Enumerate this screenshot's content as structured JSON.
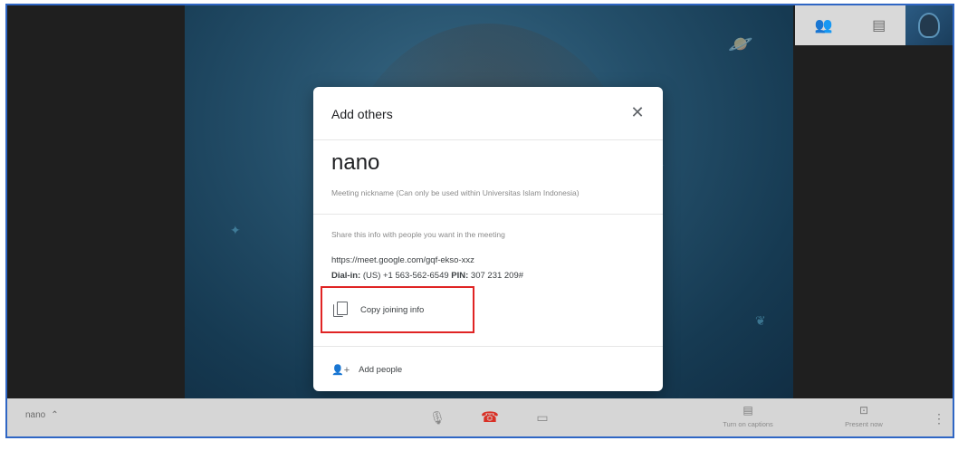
{
  "dialog": {
    "title": "Add others",
    "nickname": "nano",
    "nickname_note": "Meeting nickname (Can only be used within Universitas Islam Indonesia)",
    "share_note": "Share this info with people you want in the meeting",
    "meet_link": "https://meet.google.com/gqf-ekso-xxz",
    "dial_in_label": "Dial-in:",
    "dial_in_number": "(US) +1 563-562-6549",
    "pin_label": "PIN:",
    "pin_value": "307 231 209#",
    "copy_label": "Copy joining info",
    "add_people_label": "Add people"
  },
  "bottom_bar": {
    "meeting_name": "nano",
    "captions_label": "Turn on captions",
    "present_label": "Present now"
  },
  "icons": {
    "close": "close-icon",
    "copy": "copy-icon",
    "add_person": "add-person-icon",
    "mic": "mic-icon",
    "hangup": "hangup-icon",
    "camera": "camera-icon",
    "captions": "captions-icon",
    "present": "present-icon",
    "more": "more-vert-icon",
    "people": "people-icon",
    "chat": "chat-icon"
  },
  "colors": {
    "highlight_box": "#e02424",
    "hangup": "#d93025",
    "frame_border": "#2f66c4"
  }
}
